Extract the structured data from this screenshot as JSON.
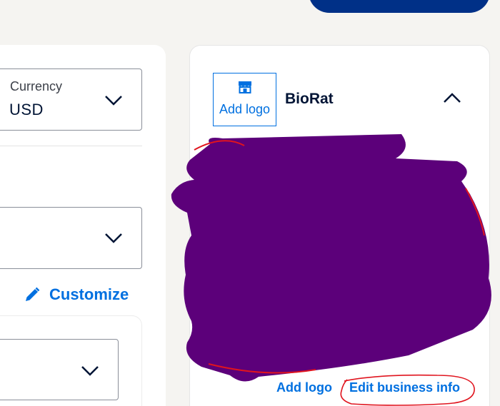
{
  "header": {
    "primary_button_label": ""
  },
  "left_panel": {
    "currency": {
      "label": "Currency",
      "value": "USD"
    },
    "second_select": {
      "value": ""
    },
    "customize_label": "Customize",
    "third_select": {
      "value": ""
    }
  },
  "right_panel": {
    "add_logo_label": "Add logo",
    "business_name": "BioRat",
    "links": {
      "add_logo": "Add logo",
      "edit_business_info": "Edit business info"
    }
  },
  "icons": {
    "store": "store-icon",
    "pencil": "pencil-icon",
    "chevron_down": "chevron-down-icon",
    "chevron_up": "chevron-up-icon"
  },
  "colors": {
    "brand_dark": "#003087",
    "link_blue": "#0070e0",
    "redaction": "#5c007a",
    "annotation_red": "#e0141e"
  }
}
